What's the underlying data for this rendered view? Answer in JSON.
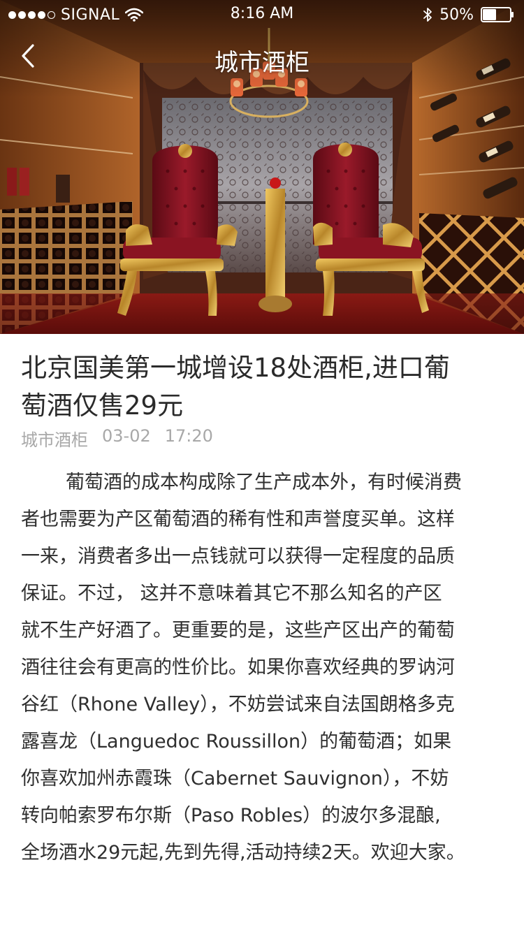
{
  "status_bar": {
    "carrier": "SIGNAL",
    "time": "8:16 AM",
    "battery": "50%",
    "battery_level": 0.5,
    "signal_bars_on": 4,
    "signal_bars_total": 5,
    "icons": [
      "signal-dots-icon",
      "wifi-icon",
      "bluetooth-icon",
      "battery-icon"
    ]
  },
  "nav": {
    "title": "城市酒柜",
    "back_icon": "chevron-left-icon"
  },
  "hero": {
    "image_subject": "wine-cellar-photo"
  },
  "article": {
    "title_line1": "北京国美第一城增设18处酒柜,进口葡",
    "title_line2": "萄酒仅售29元",
    "source": "城市酒柜",
    "date": "03-02",
    "time": "17:20",
    "body_lines": [
      "葡萄酒的成本构成除了生产成本外，有时候消费",
      "者也需要为产区葡萄酒的稀有性和声誉度买单。这样",
      "一来，消费者多出一点钱就可以获得一定程度的品质",
      "保证。不过， 这并不意味着其它不那么知名的产区",
      "就不生产好酒了。更重要的是，这些产区出产的葡萄",
      "酒往往会有更高的性价比。如果你喜欢经典的罗讷河",
      "谷红（Rhone Valley），不妨尝试来自法国朗格多克",
      "露喜龙（Languedoc Roussillon）的葡萄酒；如果",
      "你喜欢加州赤霞珠（Cabernet Sauvignon），不妨",
      "转向帕索罗布尔斯（Paso Robles）的波尔多混酿,",
      "全场酒水29元起,先到先得,活动持续2天。欢迎大家。"
    ]
  },
  "colors": {
    "title_text": "#2a2a2a",
    "meta_text": "#a8a8a8",
    "body_text": "#2f2f2f",
    "nav_text": "#ffffff"
  }
}
